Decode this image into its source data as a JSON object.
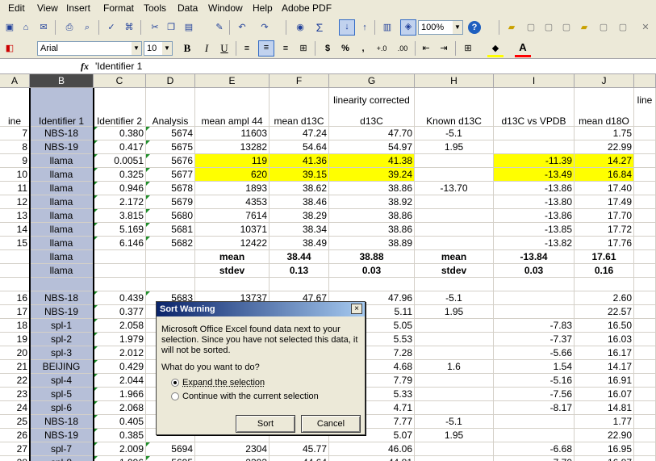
{
  "menu": [
    "Edit",
    "View",
    "Insert",
    "Format",
    "Tools",
    "Data",
    "Window",
    "Help",
    "Adobe PDF"
  ],
  "toolbar": {
    "zoom": "100%",
    "font_name": "Arial",
    "font_size": "10",
    "bold_label": "B",
    "italic_label": "I",
    "underline_label": "U",
    "currency_label": "$",
    "percent_label": "%",
    "comma_label": ",",
    "sigma_label": "Σ",
    "help_label": "?",
    "font_color_label": "A",
    "increase_decimal_label": "+.0",
    "decrease_decimal_label": ".00",
    "fill_color": "#ffff00",
    "font_color": "#ff0000"
  },
  "formula_bar": {
    "fx_label": "fx",
    "content": "'Identifier 1"
  },
  "columns": [
    "A",
    "B",
    "C",
    "D",
    "E",
    "F",
    "G",
    "H",
    "I",
    "J",
    ""
  ],
  "header_rows": {
    "row1": [
      "",
      "",
      "",
      "",
      "",
      "",
      "linearity corrected",
      "",
      "",
      "",
      "line"
    ],
    "row2": [
      "ine",
      "Identifier 1",
      "Identifier 2",
      "Analysis",
      "mean ampl 44",
      "mean d13C",
      "d13C",
      "Known d13C",
      "d13C vs VPDB",
      "mean d18O",
      ""
    ]
  },
  "rows": [
    [
      "7",
      "NBS-18",
      "0.380",
      "5674",
      "11603",
      "47.24",
      "47.70",
      "-5.1",
      "",
      "1.75"
    ],
    [
      "8",
      "NBS-19",
      "0.417",
      "5675",
      "13282",
      "54.64",
      "54.97",
      "1.95",
      "",
      "22.99"
    ],
    [
      "9",
      "llama",
      "0.0051",
      "5676",
      "119",
      "41.36",
      "41.38",
      "",
      "-11.39",
      "14.27"
    ],
    [
      "10",
      "llama",
      "0.325",
      "5677",
      "620",
      "39.15",
      "39.24",
      "",
      "-13.49",
      "16.84"
    ],
    [
      "11",
      "llama",
      "0.946",
      "5678",
      "1893",
      "38.62",
      "38.86",
      "-13.70",
      "-13.86",
      "17.40"
    ],
    [
      "12",
      "llama",
      "2.172",
      "5679",
      "4353",
      "38.46",
      "38.92",
      "",
      "-13.80",
      "17.49"
    ],
    [
      "13",
      "llama",
      "3.815",
      "5680",
      "7614",
      "38.29",
      "38.86",
      "",
      "-13.86",
      "17.70"
    ],
    [
      "14",
      "llama",
      "5.169",
      "5681",
      "10371",
      "38.34",
      "38.86",
      "",
      "-13.85",
      "17.72"
    ],
    [
      "15",
      "llama",
      "6.146",
      "5682",
      "12422",
      "38.49",
      "38.89",
      "",
      "-13.82",
      "17.76"
    ],
    [
      "",
      "llama",
      "",
      "",
      "mean",
      "38.44",
      "38.88",
      "mean",
      "-13.84",
      "17.61"
    ],
    [
      "",
      "llama",
      "",
      "",
      "stdev",
      "0.13",
      "0.03",
      "stdev",
      "0.03",
      "0.16"
    ],
    [
      "",
      "",
      "",
      "",
      "",
      "",
      "",
      "",
      "",
      ""
    ],
    [
      "16",
      "NBS-18",
      "0.439",
      "5683",
      "13737",
      "47.67",
      "47.96",
      "-5.1",
      "",
      "2.60"
    ],
    [
      "17",
      "NBS-19",
      "0.377",
      "",
      "",
      "",
      "5.11",
      "1.95",
      "",
      "22.57"
    ],
    [
      "18",
      "spl-1",
      "2.058",
      "",
      "",
      "",
      "5.05",
      "",
      "-7.83",
      "16.50"
    ],
    [
      "19",
      "spl-2",
      "1.979",
      "",
      "",
      "",
      "5.53",
      "",
      "-7.37",
      "16.03"
    ],
    [
      "20",
      "spl-3",
      "2.012",
      "",
      "",
      "",
      "7.28",
      "",
      "-5.66",
      "16.17"
    ],
    [
      "21",
      "BEIJING",
      "0.429",
      "",
      "",
      "",
      "4.68",
      "1.6",
      "1.54",
      "14.17"
    ],
    [
      "22",
      "spl-4",
      "2.044",
      "",
      "",
      "",
      "7.79",
      "",
      "-5.16",
      "16.91"
    ],
    [
      "23",
      "spl-5",
      "1.966",
      "",
      "",
      "",
      "5.33",
      "",
      "-7.56",
      "16.07"
    ],
    [
      "24",
      "spl-6",
      "2.068",
      "",
      "",
      "",
      "4.71",
      "",
      "-8.17",
      "14.81"
    ],
    [
      "25",
      "NBS-18",
      "0.405",
      "",
      "",
      "",
      "7.77",
      "-5.1",
      "",
      "1.77"
    ],
    [
      "26",
      "NBS-19",
      "0.385",
      "",
      "",
      "",
      "5.07",
      "1.95",
      "",
      "22.90"
    ],
    [
      "27",
      "spl-7",
      "2.009",
      "5694",
      "2304",
      "45.77",
      "46.06",
      "",
      "-6.68",
      "16.95"
    ],
    [
      "28",
      "spl-8",
      "1.996",
      "5695",
      "2393",
      "44.64",
      "44.81",
      "",
      "-7.70",
      "16.87"
    ]
  ],
  "dialog": {
    "title": "Sort Warning",
    "close_label": "×",
    "message_line1": "Microsoft Office Excel found data next to your",
    "message_line2": "selection.  Since you have not selected this data, it",
    "message_line3": "will not be sorted.",
    "question": "What do you want to do?",
    "option1": "Expand the selection",
    "option2": "Continue with the current selection",
    "sort_button": "Sort",
    "cancel_button": "Cancel"
  }
}
